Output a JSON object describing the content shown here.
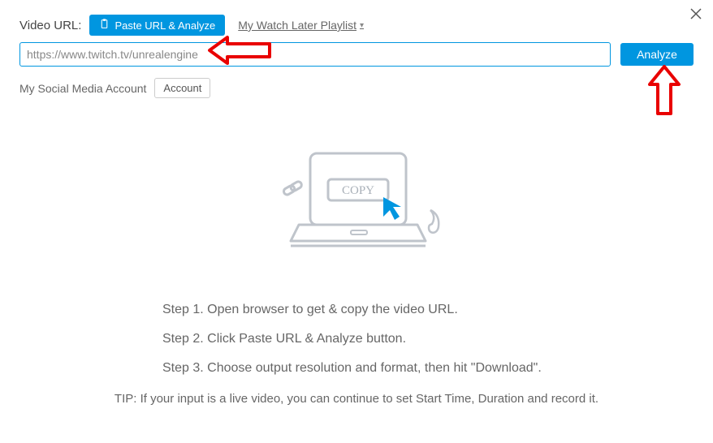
{
  "header": {
    "url_label": "Video URL:",
    "paste_btn_label": "Paste URL & Analyze",
    "playlist_link": "My Watch Later Playlist"
  },
  "url_input": {
    "value": "https://www.twitch.tv/unrealengine"
  },
  "analyze_btn_label": "Analyze",
  "social": {
    "label": "My Social Media Account",
    "account_btn_label": "Account"
  },
  "illustration": {
    "copy_label": "COPY"
  },
  "steps": {
    "step1": "Step 1. Open browser to get & copy the video URL.",
    "step2": "Step 2. Click Paste URL & Analyze button.",
    "step3": "Step 3. Choose output resolution and format, then hit \"Download\"."
  },
  "tip": "TIP: If your input is a live video, you can continue to set Start Time, Duration and record it."
}
